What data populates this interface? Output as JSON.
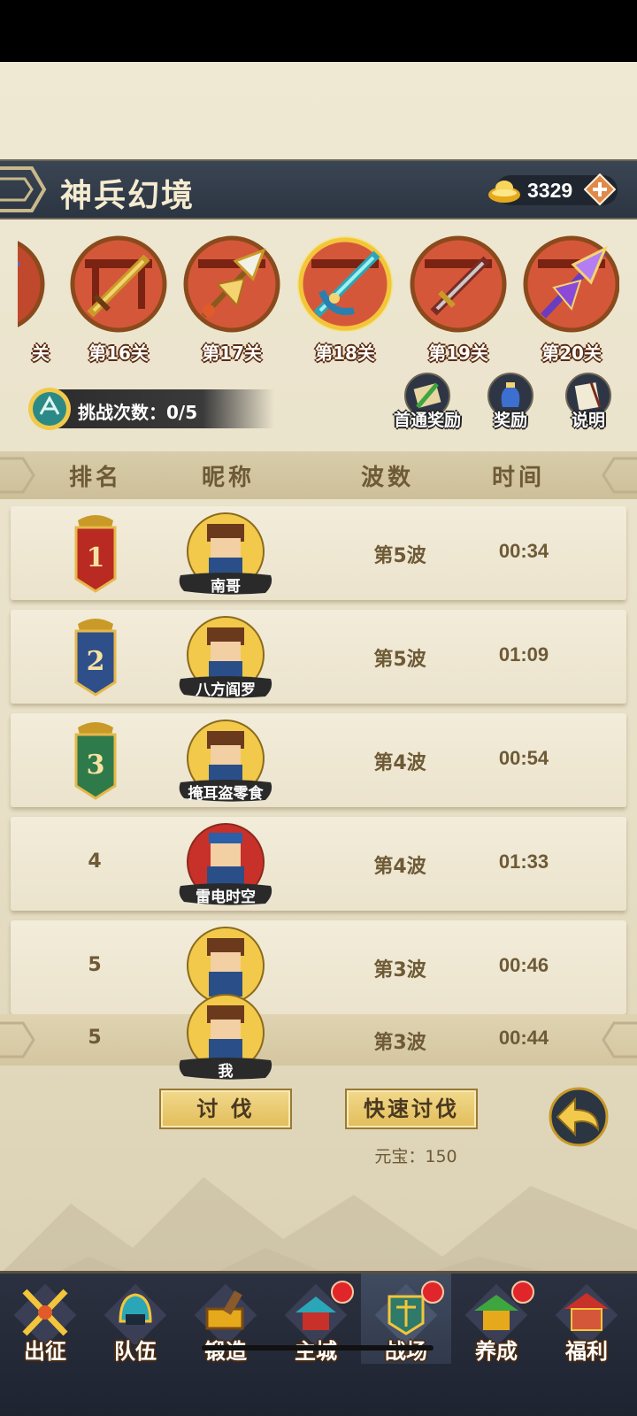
{
  "header": {
    "title": "神兵幻境",
    "currency_value": "3329"
  },
  "stages": [
    {
      "label": "关",
      "variant": "partial"
    },
    {
      "label": "第16关",
      "variant": "sword"
    },
    {
      "label": "第17关",
      "variant": "halberd"
    },
    {
      "label": "第18关",
      "variant": "crescent",
      "selected": true
    },
    {
      "label": "第19关",
      "variant": "dagger"
    },
    {
      "label": "第20关",
      "variant": "purple"
    }
  ],
  "challenge": {
    "text": "挑战次数：0/5"
  },
  "buttons": {
    "first_clear": "首通奖励",
    "reward": "奖励",
    "info": "说明"
  },
  "table": {
    "headers": {
      "rank": "排名",
      "nickname": "昵称",
      "waves": "波数",
      "time": "时间"
    },
    "rows": [
      {
        "rank": "1",
        "nick": "南哥",
        "wave": "第5波",
        "time": "00:34"
      },
      {
        "rank": "2",
        "nick": "八方阎罗",
        "wave": "第5波",
        "time": "01:09"
      },
      {
        "rank": "3",
        "nick": "掩耳盗零食",
        "wave": "第4波",
        "time": "00:54"
      },
      {
        "rank": "4",
        "nick": "雷电时空",
        "wave": "第4波",
        "time": "01:33"
      },
      {
        "rank": "5",
        "nick": "",
        "wave": "第3波",
        "time": "00:46"
      }
    ],
    "self": {
      "rank": "5",
      "nick": "我",
      "wave": "第3波",
      "time": "00:44"
    }
  },
  "actions": {
    "attack": "讨 伐",
    "quick_attack": "快速讨伐",
    "cost": "元宝：150"
  },
  "nav": [
    {
      "label": "出征",
      "badge": false
    },
    {
      "label": "队伍",
      "badge": false
    },
    {
      "label": "锻造",
      "badge": false
    },
    {
      "label": "主城",
      "badge": true
    },
    {
      "label": "战场",
      "badge": true,
      "active": true
    },
    {
      "label": "养成",
      "badge": true
    },
    {
      "label": "福利",
      "badge": false
    }
  ],
  "colors": {
    "header_bg": "#2c3542",
    "text_brown": "#6e5a36",
    "gold": "#e2bd5a",
    "badge_red": "#e0262a"
  }
}
